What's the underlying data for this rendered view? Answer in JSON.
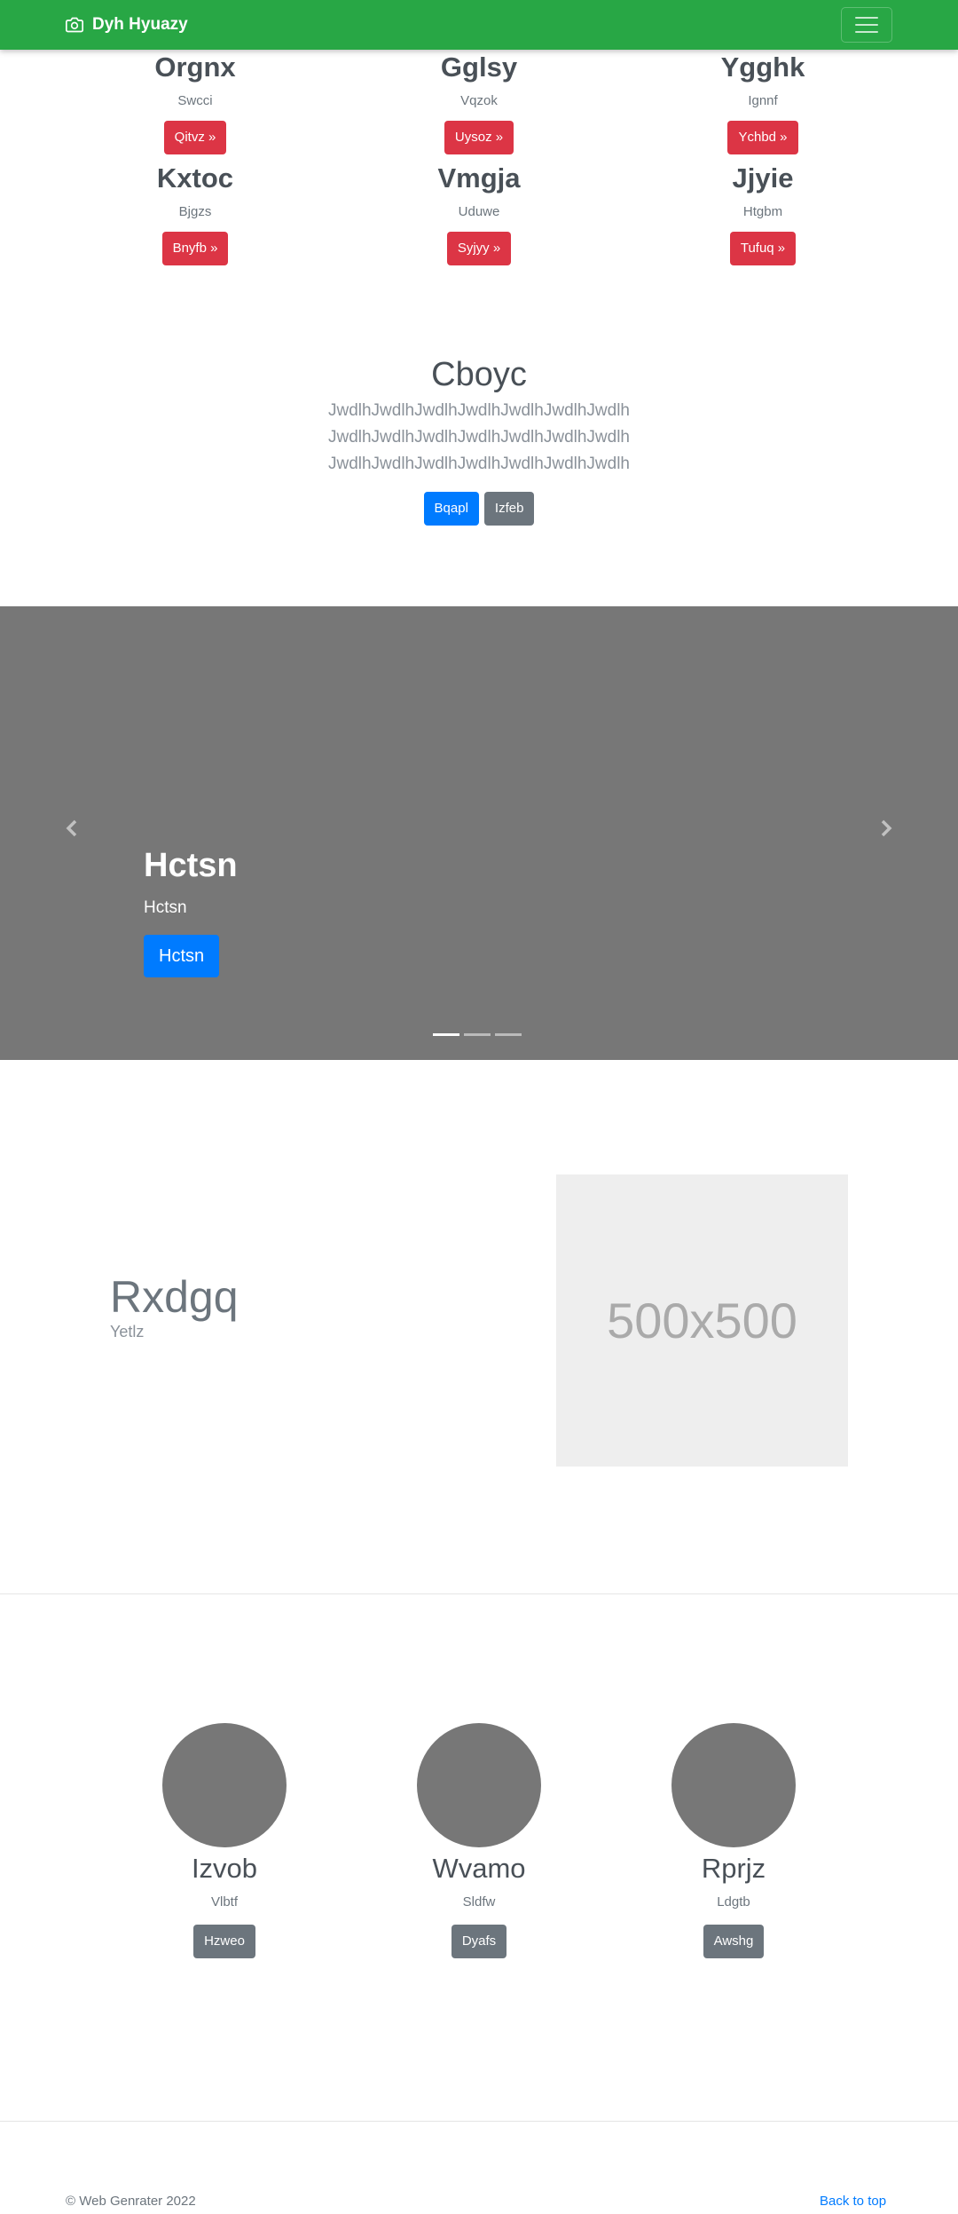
{
  "navbar": {
    "brand": "Dyh Hyuazy",
    "brand_icon": "camera-icon",
    "toggler_icon": "hamburger-icon"
  },
  "features": [
    {
      "title": "Orgnx",
      "text": "Swcci",
      "button": "Qitvz »"
    },
    {
      "title": "Gglsy",
      "text": "Vqzok",
      "button": "Uysoz »"
    },
    {
      "title": "Ygghk",
      "text": "Ignnf",
      "button": "Ychbd »"
    },
    {
      "title": "Kxtoc",
      "text": "Bjgzs",
      "button": "Bnyfb »"
    },
    {
      "title": "Vmgja",
      "text": "Uduwe",
      "button": "Syjyy »"
    },
    {
      "title": "Jjyie",
      "text": "Htgbm",
      "button": "Tufuq »"
    }
  ],
  "jumbotron": {
    "title": "Cboyc",
    "lead": "JwdlhJwdlhJwdlhJwdlhJwdlhJwdlhJwdlh JwdlhJwdlhJwdlhJwdlhJwdlhJwdlhJwdlh JwdlhJwdlhJwdlhJwdlhJwdlhJwdlhJwdlh",
    "primary_button": "Bqapl",
    "secondary_button": "Izfeb"
  },
  "carousel": {
    "title": "Hctsn",
    "text": "Hctsn",
    "button": "Hctsn",
    "slides": 3,
    "active_slide": 1
  },
  "featurette": {
    "title": "Rxdgq",
    "subtitle": "Yetlz",
    "image_label": "500x500"
  },
  "team": [
    {
      "name": "Izvob",
      "text": "Vlbtf",
      "button": "Hzweo"
    },
    {
      "name": "Wvamo",
      "text": "Sldfw",
      "button": "Dyafs"
    },
    {
      "name": "Rprjz",
      "text": "Ldgtb",
      "button": "Awshg"
    }
  ],
  "footer": {
    "copyright": "© Web Genrater 2022",
    "back_to_top": "Back to top"
  },
  "colors": {
    "navbar": "#28a745",
    "danger": "#dc3545",
    "primary": "#007bff",
    "secondary": "#6c757d",
    "carousel_bg": "#777777"
  }
}
